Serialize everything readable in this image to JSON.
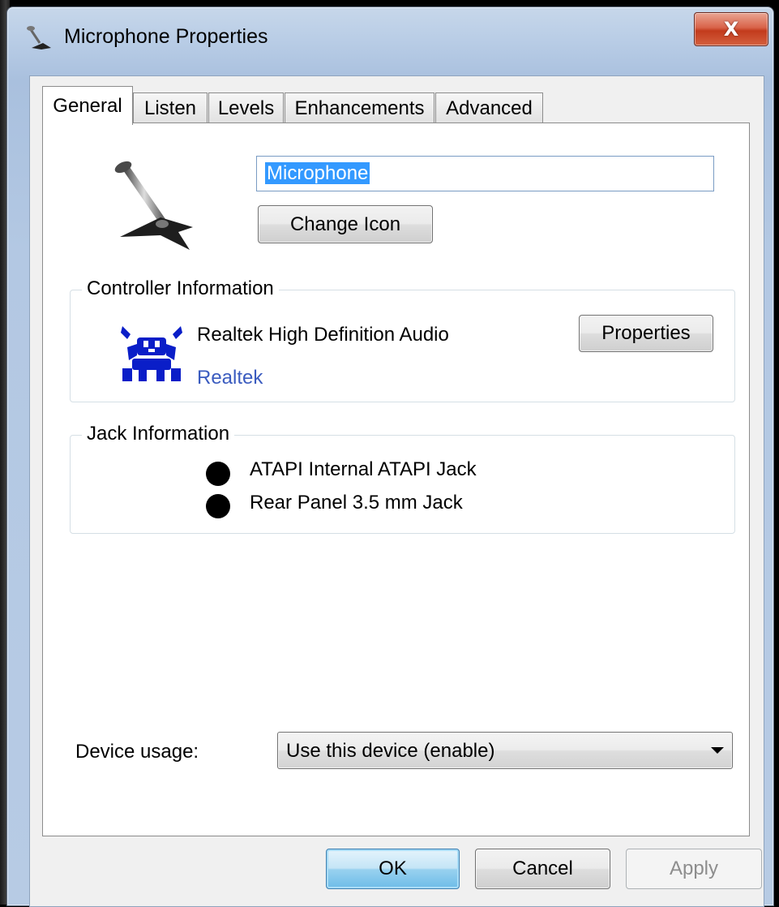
{
  "window": {
    "title": "Microphone Properties",
    "close_glyph": "X"
  },
  "tabs": [
    {
      "label": "General",
      "active": true
    },
    {
      "label": "Listen",
      "active": false
    },
    {
      "label": "Levels",
      "active": false
    },
    {
      "label": "Enhancements",
      "active": false
    },
    {
      "label": "Advanced",
      "active": false
    }
  ],
  "general": {
    "device_icon": "microphone-icon",
    "name_value": "Microphone",
    "change_icon_label": "Change Icon",
    "controller": {
      "title": "Controller Information",
      "icon": "realtek-crab-icon",
      "name": "Realtek High Definition Audio",
      "vendor_link": "Realtek",
      "properties_label": "Properties"
    },
    "jack": {
      "title": "Jack Information",
      "items": [
        {
          "label": "ATAPI Internal ATAPI Jack",
          "color": "#000000"
        },
        {
          "label": "Rear Panel 3.5 mm Jack",
          "color": "#000000"
        }
      ]
    },
    "device_usage": {
      "label": "Device usage:",
      "selected": "Use this device (enable)"
    }
  },
  "footer": {
    "ok": "OK",
    "cancel": "Cancel",
    "apply": "Apply"
  },
  "colors": {
    "selection": "#3399ff",
    "link": "#3a5bbf",
    "close_button": "#c23b1c"
  }
}
